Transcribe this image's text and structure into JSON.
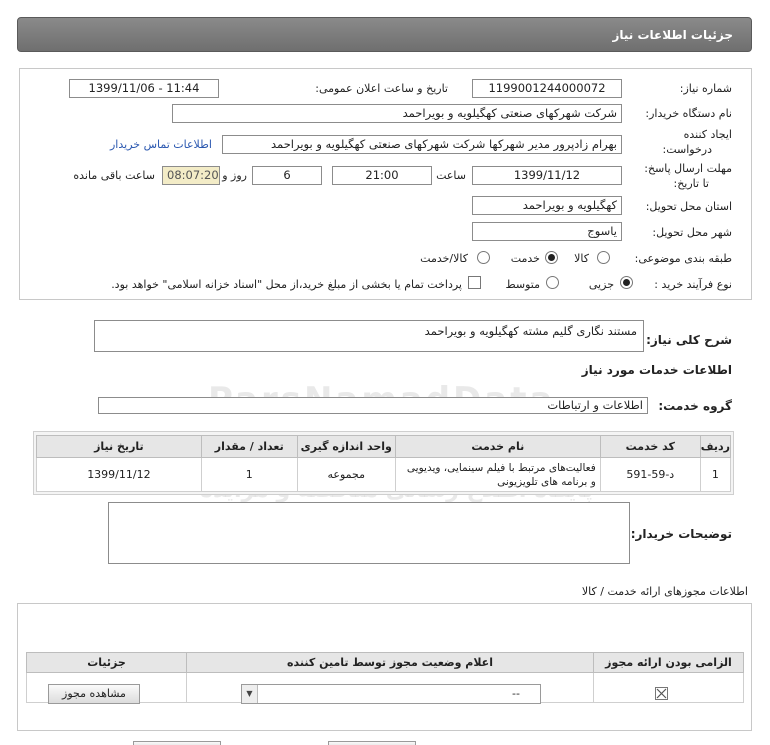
{
  "header": {
    "title": "جزئیات اطلاعات نیاز"
  },
  "form": {
    "need_number_label": "شماره نیاز:",
    "need_number": "1199001244000072",
    "announce_label": "تاریخ و ساعت اعلان عمومی:",
    "announce_value": "1399/11/06 - 11:44",
    "buyer_org_label": "نام دستگاه خریدار:",
    "buyer_org": "شرکت شهرکهای صنعتی کهگیلویه و بویراحمد",
    "creator_label_1": "ایجاد کننده",
    "creator_label_2": "درخواست:",
    "creator": "بهرام زادپرور مدیر شهرکها شرکت شهرکهای صنعتی کهگیلویه و بویراحمد",
    "contact_link": "اطلاعات تماس خریدار",
    "deadline_label_1": "مهلت ارسال پاسخ:",
    "deadline_label_2": "تا تاریخ:",
    "deadline_date": "1399/11/12",
    "time_label": "ساعت",
    "deadline_time": "21:00",
    "days_value": "6",
    "days_label": "روز و",
    "remaining_time": "08:07:20",
    "remaining_label": "ساعت باقی مانده",
    "province_label": "استان محل تحویل:",
    "province": "کهگیلویه و بویراحمد",
    "city_label": "شهر محل تحویل:",
    "city": "یاسوج",
    "category_label": "طبقه بندی موضوعی:",
    "category_options": [
      "کالا",
      "خدمت",
      "کالا/خدمت"
    ],
    "category_selected": "خدمت",
    "process_label": "نوع فرآیند خرید :",
    "process_options": [
      "جزیی",
      "متوسط"
    ],
    "process_selected": "جزیی",
    "payment_note": "پرداخت تمام یا بخشی از مبلغ خرید،از محل \"اسناد خزانه اسلامی\" خواهد بود."
  },
  "summary": {
    "label": "شرح کلی نیاز:",
    "value": "مستند نگاری گلیم مشته کهگیلویه و بویراحمد"
  },
  "services": {
    "section_title": "اطلاعات خدمات مورد نیاز",
    "group_label": "گروه خدمت:",
    "group_value": "اطلاعات و ارتباطات",
    "columns": [
      "ردیف",
      "کد خدمت",
      "نام خدمت",
      "واحد اندازه گیری",
      "تعداد / مقدار",
      "تاریخ نیاز"
    ],
    "rows": [
      {
        "index": "1",
        "code": "د-59-591",
        "name": "فعالیت‌های مرتبط با فیلم سینمایی، ویدیویی و برنامه های تلویزیونی",
        "unit": "مجموعه",
        "qty": "1",
        "date": "1399/11/12"
      }
    ]
  },
  "buyer_notes": {
    "label": "توضیحات خریدار:",
    "value": ""
  },
  "permits": {
    "title": "اطلاعات مجوزهای ارائه خدمت / کالا",
    "columns": [
      "الزامی بودن ارائه مجوز",
      "اعلام وضعیت مجوز توسط تامین کننده",
      "جزئیات"
    ],
    "row": {
      "select_value": "--",
      "view_button": "مشاهده مجوز"
    }
  },
  "watermark": {
    "line1": "ParsNamadData",
    "line2": "مرکز فراهم آوری اطلاعات پارس نماد داده",
    "line3": "پایگاه اطلاع رسانی مناقصه و مزایده",
    "phone": "۰۲۱-۸۸۳۴۹۶۷۰-۵",
    "digits": "010101"
  }
}
